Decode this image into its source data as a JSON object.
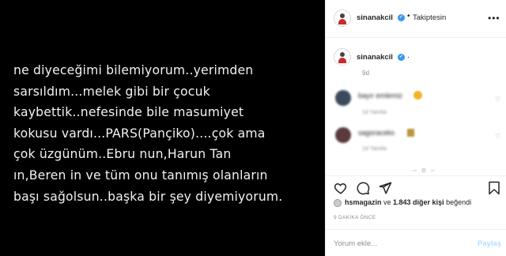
{
  "post": {
    "text_lines": [
      "ne diyeceğimi bilemiyorum..yerimden",
      "sarsıldım...melek gibi bir çocuk",
      "kaybettik..nefesinde bile masumiyet",
      "kokusu vardı...PARS(Pançiko)....çok ama",
      "çok üzgünüm..Ebru nun,Harun Tan",
      "ın,Beren in ve tüm onu tanımış olanların",
      "başı sağolsun..başka bir şey diyemiyorum."
    ]
  },
  "header": {
    "username": "sinanakcil",
    "separator": "•",
    "follow_status": "Takiptesin",
    "more_icon": "more-horizontal-icon"
  },
  "caption": {
    "username": "sinanakcil",
    "text": ".",
    "age": "9d"
  },
  "comments": [
    {
      "text": "bayır emlemiz",
      "meta": "1d   Yanıtla",
      "emoji_color": "#f3b42a",
      "avatar_color": "#3a4a5a"
    },
    {
      "text": "sagoraceks",
      "meta": "1d   Yanıtla",
      "emoji_color": "#b8963e",
      "avatar_color": "#5a3a3a"
    }
  ],
  "load_more": "– o –",
  "actions": {
    "like_icon": "heart-icon",
    "comment_icon": "comment-icon",
    "share_icon": "share-icon",
    "save_icon": "bookmark-icon"
  },
  "likes": {
    "user": "hsmagazin",
    "middle": " ve ",
    "count": "1.843 diğer kişi",
    "suffix": " beğendi"
  },
  "time_ago": "9 DAKİKA ÖNCE",
  "comment_box": {
    "placeholder": "Yorum ekle...",
    "post_label": "Paylaş"
  },
  "colors": {
    "verified": "#3897f0",
    "post_button": "#b2dffc",
    "image_bg": "#000000"
  }
}
